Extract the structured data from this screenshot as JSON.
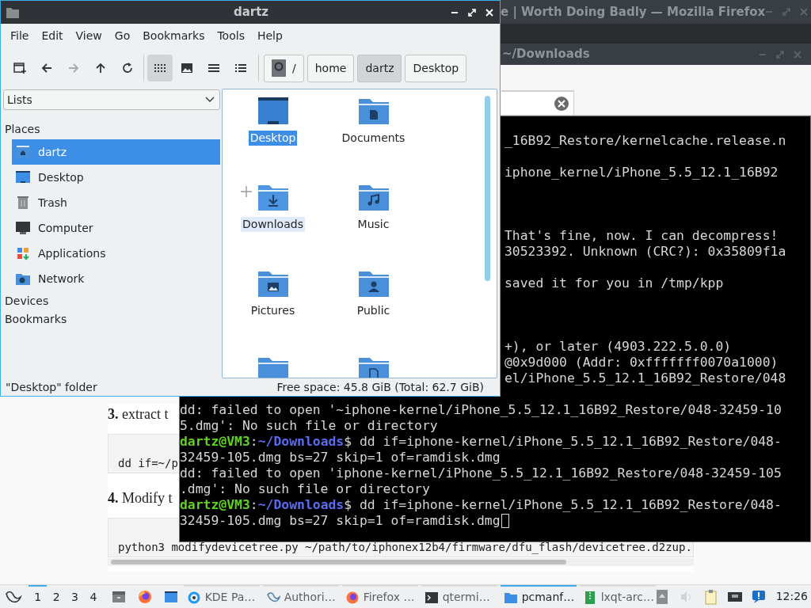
{
  "browser": {
    "title": "e | Worth Doing Badly — Mozilla Firefox",
    "article": [
      {
        "kind": "step",
        "text": "**3.** extract t"
      },
      {
        "kind": "code",
        "text": "dd if=~/p"
      },
      {
        "kind": "step",
        "text": "**4.** Modify t"
      },
      {
        "kind": "code",
        "text": "python3 modifydevicetree.py ~/path/to/iphonex12b4/firmware/dfu_flash/devicetree.d2zup."
      }
    ]
  },
  "terminal": {
    "title": "~/Downloads",
    "lines": [
      {
        "kind": "fragment",
        "text": "_16B92_Restore/kernelcache.release.n"
      },
      {
        "kind": "blank"
      },
      {
        "kind": "fragment",
        "text": "iphone_kernel/iPhone_5.5_12.1_16B92"
      },
      {
        "kind": "blank"
      },
      {
        "kind": "blank"
      },
      {
        "kind": "blank"
      },
      {
        "kind": "fragment",
        "text": "That's fine, now. I can decompress!"
      },
      {
        "kind": "fragment",
        "text": "30523392. Unknown (CRC?): 0x35809f1a"
      },
      {
        "kind": "blank"
      },
      {
        "kind": "fragment",
        "text": "saved it for you in /tmp/kpp"
      },
      {
        "kind": "blank"
      },
      {
        "kind": "blank"
      },
      {
        "kind": "blank"
      },
      {
        "kind": "fragment",
        "text": "+), or later (4903.222.5.0.0)"
      },
      {
        "kind": "fragment",
        "text": "@0x9d000 (Addr: 0xfffffff0070a1000)"
      },
      {
        "kind": "fragment",
        "text": "el/iPhone_5.5_12.1_16B92_Restore/048"
      },
      {
        "kind": "blank"
      },
      {
        "kind": "output",
        "text": "dd: failed to open '~iphone-kernel/iPhone_5.5_12.1_16B92_Restore/048-32459-10"
      },
      {
        "kind": "output",
        "text": "5.dmg': No such file or directory"
      },
      {
        "kind": "prompt",
        "user": "dartz@VM3",
        "sep": ":",
        "path": "~/Downloads",
        "text": "$ dd if=iphone-kernel/iPhone_5.5_12.1_16B92_Restore/048-"
      },
      {
        "kind": "output",
        "text": "32459-105.dmg bs=27 skip=1 of=ramdisk.dmg"
      },
      {
        "kind": "output",
        "text": "dd: failed to open 'iphone-kernel/iPhone_5.5_12.1_16B92_Restore/048-32459-105"
      },
      {
        "kind": "output",
        "text": ".dmg': No such file or directory"
      },
      {
        "kind": "prompt",
        "user": "dartz@VM3",
        "sep": ":",
        "path": "~/Downloads",
        "text": "$ dd if=iphone-kernel/iPhone_5.5_12.1_16B92_Restore/048-"
      },
      {
        "kind": "output",
        "text": "32459-105.dmg bs=27 skip=1 of=ramdisk.dmg",
        "cursor": true
      }
    ]
  },
  "file_manager": {
    "title": "dartz",
    "menu": [
      "File",
      "Edit",
      "View",
      "Go",
      "Bookmarks",
      "Tools",
      "Help"
    ],
    "nav_buttons": [
      {
        "kind": "new-tab",
        "disabled": false
      },
      {
        "kind": "back",
        "disabled": false
      },
      {
        "kind": "forward",
        "disabled": true
      },
      {
        "kind": "up",
        "disabled": false
      },
      {
        "kind": "reload",
        "disabled": false
      }
    ],
    "view_modes": [
      {
        "kind": "icons",
        "selected": true
      },
      {
        "kind": "thumbnails",
        "selected": false
      },
      {
        "kind": "compact",
        "selected": false
      },
      {
        "kind": "details",
        "selected": false
      }
    ],
    "path": [
      {
        "label": "/",
        "kind": "root",
        "selected": false
      },
      {
        "label": "home",
        "kind": "dir",
        "selected": false
      },
      {
        "label": "dartz",
        "kind": "dir",
        "selected": true
      },
      {
        "label": "Desktop",
        "kind": "dir",
        "selected": false
      }
    ],
    "sidebar": {
      "dropdown": "Lists",
      "sections": [
        {
          "title": "Places",
          "items": [
            {
              "label": "dartz",
              "kind": "home",
              "selected": true
            },
            {
              "label": "Desktop",
              "kind": "desktop",
              "selected": false
            },
            {
              "label": "Trash",
              "kind": "trash",
              "selected": false
            },
            {
              "label": "Computer",
              "kind": "computer",
              "selected": false
            },
            {
              "label": "Applications",
              "kind": "applications",
              "selected": false
            },
            {
              "label": "Network",
              "kind": "network",
              "selected": false
            }
          ]
        },
        {
          "title": "Devices"
        },
        {
          "title": "Bookmarks"
        }
      ]
    },
    "files": [
      {
        "name": "Desktop",
        "kind": "desktop",
        "selected": true,
        "hovered": false
      },
      {
        "name": "Documents",
        "kind": "documents",
        "selected": false,
        "hovered": false
      },
      {
        "name": "Downloads",
        "kind": "downloads",
        "selected": false,
        "hovered": true
      },
      {
        "name": "Music",
        "kind": "music",
        "selected": false,
        "hovered": false
      },
      {
        "name": "Pictures",
        "kind": "pictures",
        "selected": false,
        "hovered": false
      },
      {
        "name": "Public",
        "kind": "public",
        "selected": false,
        "hovered": false
      },
      {
        "kind": "folder",
        "selected": false,
        "hovered": false
      },
      {
        "kind": "file",
        "selected": false,
        "hovered": false
      }
    ],
    "status": {
      "left": "\"Desktop\" folder",
      "right": "Free space: 45.8 GiB (Total: 62.7 GiB)"
    }
  },
  "taskbar": {
    "desktops": [
      {
        "label": "1",
        "selected": true
      },
      {
        "label": "2",
        "selected": false
      },
      {
        "label": "3",
        "selected": false
      },
      {
        "label": "4",
        "selected": false
      }
    ],
    "launchers": [
      {
        "kind": "files"
      },
      {
        "kind": "firefox"
      },
      {
        "kind": "desktop"
      }
    ],
    "tasks": [
      {
        "label": "KDE Pa…",
        "kind": "kde",
        "active": false
      },
      {
        "label": "Authori…",
        "kind": "bird",
        "active": false
      },
      {
        "label": "Firefox …",
        "kind": "firefox",
        "active": false
      },
      {
        "label": "qtermi…",
        "kind": "terminal",
        "active": false
      },
      {
        "label": "pcmanf…",
        "kind": "folder",
        "active": true
      },
      {
        "label": "lxqt-arc…",
        "kind": "archive",
        "active": false
      }
    ],
    "tray": [
      {
        "kind": "box"
      },
      {
        "kind": "volume"
      },
      {
        "kind": "clipboard"
      },
      {
        "kind": "network"
      },
      {
        "kind": "notification"
      }
    ],
    "clock": "12:26"
  }
}
